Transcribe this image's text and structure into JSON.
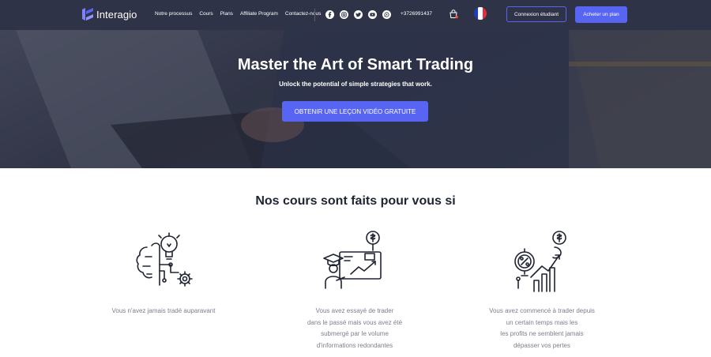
{
  "brand": {
    "name": "Interagio"
  },
  "nav": {
    "links": [
      "Notre processus",
      "Cours",
      "Plans",
      "Affiliate Program",
      "Contactez-nous"
    ],
    "phone": "+3726991437",
    "socials": [
      "facebook-icon",
      "instagram-icon",
      "twitter-icon",
      "youtube-icon",
      "whatsapp-icon"
    ],
    "login_label": "Connexion étudiant",
    "buy_label": "Acheter un plan"
  },
  "hero": {
    "title": "Master the Art of Smart Trading",
    "subtitle": "Unlock the potential of simple strategies that work.",
    "cta_label": "OBTENIR UNE LEÇON VIDÉO GRATUITE"
  },
  "courses": {
    "title": "Nos cours sont faits pour vous si",
    "cards": [
      {
        "icon": "brain-bulb-gear-icon",
        "lines": [
          "Vous n'avez jamais tradé auparavant"
        ]
      },
      {
        "icon": "graduate-chart-icon",
        "lines": [
          "Vous avez essayé de trader",
          "dans le passé mais vous avez été",
          "submergé par le volume",
          "d'informations redondantes"
        ]
      },
      {
        "icon": "percent-growth-icon",
        "lines": [
          "Vous avez commencé à trader depuis",
          "un certain temps mais les",
          "les profits ne semblent jamais",
          "dépasser vos pertes"
        ]
      }
    ]
  },
  "colors": {
    "nav_bg": "#2f3347",
    "accent": "#5865f2",
    "title": "#1f2433",
    "muted": "#7b7f8c"
  }
}
